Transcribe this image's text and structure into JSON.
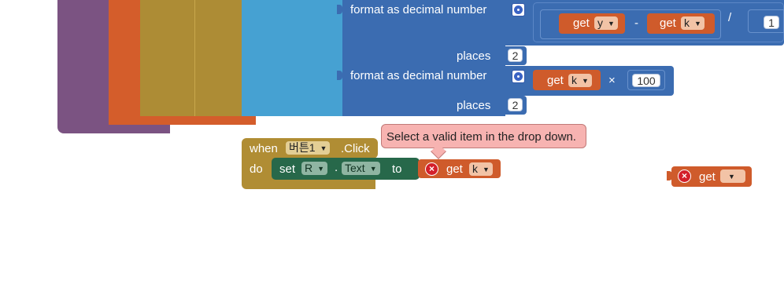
{
  "blocks": {
    "format1": {
      "label": "format as decimal number",
      "places_label": "places",
      "places_value": "2"
    },
    "expr1": {
      "get_label": "get",
      "var_y": "y",
      "minus": "-",
      "var_k": "k",
      "divide": "/",
      "one": "1"
    },
    "format2": {
      "label": "format as decimal number",
      "places_label": "places",
      "places_value": "2"
    },
    "expr2": {
      "get_label": "get",
      "var_k": "k",
      "times": "×",
      "hundred": "100"
    },
    "event": {
      "when_label": "when",
      "component": "버튼1",
      "event_name": ".Click",
      "do_label": "do",
      "set_label": "set",
      "set_component": "R",
      "dot": ".",
      "property": "Text",
      "to_label": "to",
      "get_label": "get",
      "get_var": "k"
    },
    "orphan": {
      "get_label": "get",
      "get_var": ""
    }
  },
  "tooltip": {
    "text": "Select a valid item in the drop down."
  },
  "icons": {
    "error": "error-icon",
    "mutator": "mutator-gear-icon",
    "dropdown": "dropdown-arrow-icon"
  },
  "colors": {
    "purple": "#7b5382",
    "orange_red": "#d45d2b",
    "olive": "#ad8c35",
    "light_blue": "#46a1d2",
    "math_blue": "#3b6cb1",
    "var_orange": "#cf5b2b",
    "event_gold": "#b08d34",
    "set_green": "#27684a",
    "tooltip_bg": "#f7b3b1"
  }
}
